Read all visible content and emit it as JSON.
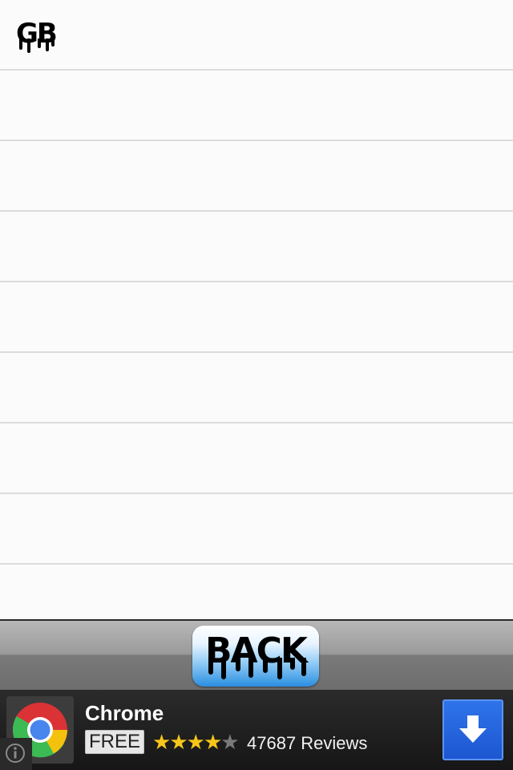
{
  "list": {
    "rows": [
      {
        "label": "GB"
      },
      {
        "label": ""
      },
      {
        "label": ""
      },
      {
        "label": ""
      },
      {
        "label": ""
      },
      {
        "label": ""
      },
      {
        "label": ""
      },
      {
        "label": ""
      },
      {
        "label": ""
      }
    ]
  },
  "toolbar": {
    "back_label": "BACK"
  },
  "ad": {
    "app_name": "Chrome",
    "price": "FREE",
    "rating_stars": 4,
    "rating_max": 5,
    "reviews": "47687 Reviews",
    "icons": {
      "app": "chrome-logo-icon",
      "download": "download-arrow-icon",
      "info": "info-icon"
    },
    "colors": {
      "star": "#f7c61a",
      "download_button": "#1f5ed6"
    }
  }
}
